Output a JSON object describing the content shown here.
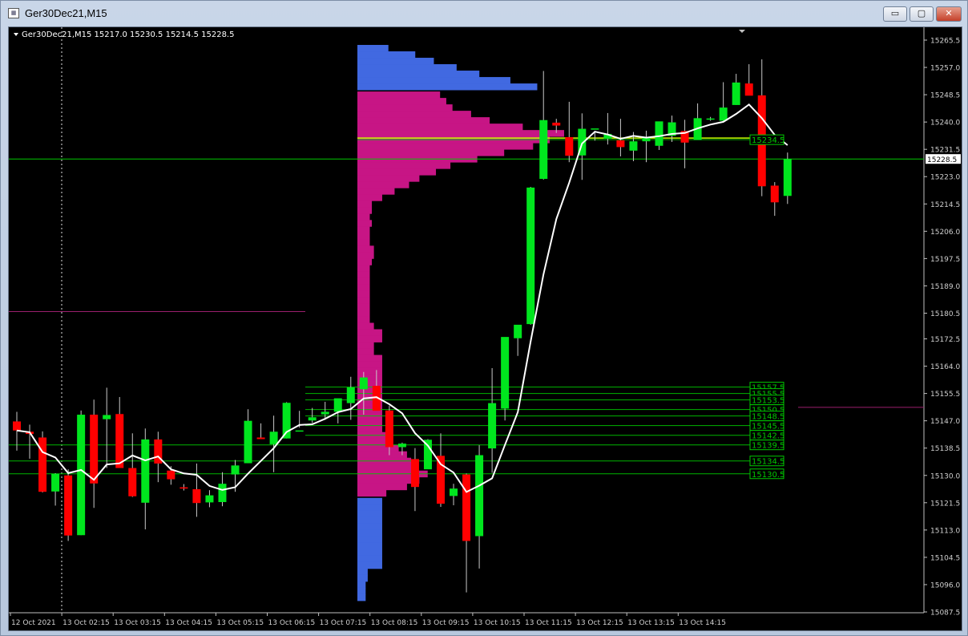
{
  "window": {
    "title": "Ger30Dec21,M15",
    "icon": "chart-window-icon",
    "buttons": {
      "minimize": "▭",
      "maximize": "▢",
      "close": "✕"
    }
  },
  "chart_header": "Ger30Dec21,M15  15217.0 15230.5 15214.5 15228.5",
  "colors": {
    "background": "#000000",
    "bull": "#00e61e",
    "bear": "#ff0000",
    "profile_main": "#c71585",
    "profile_outside": "#4169e1",
    "moving_average": "#ffffff",
    "levels": "#00c800",
    "poc": "#c8ff00",
    "marker": "#9b1f6e"
  },
  "chart_data": {
    "type": "candlestick",
    "symbol": "Ger30Dec21",
    "timeframe": "M15",
    "ohlc_header": {
      "open": 15217.0,
      "high": 15230.5,
      "low": 15214.5,
      "close": 15228.5
    },
    "y_ticks": [
      15265.5,
      15257.0,
      15248.5,
      15240.0,
      15231.5,
      15223.0,
      15214.5,
      15206.0,
      15197.5,
      15189.0,
      15180.5,
      15172.5,
      15164.0,
      15155.5,
      15147.0,
      15138.5,
      15130.0,
      15121.5,
      15113.0,
      15104.5,
      15096.0,
      15087.5
    ],
    "ylim": [
      15087.5,
      15265.5
    ],
    "x_labels": [
      "12 Oct 2021",
      "13 Oct 02:15",
      "13 Oct 03:15",
      "13 Oct 04:15",
      "13 Oct 05:15",
      "13 Oct 06:15",
      "13 Oct 07:15",
      "13 Oct 08:15",
      "13 Oct 09:15",
      "13 Oct 10:15",
      "13 Oct 11:15",
      "13 Oct 12:15",
      "13 Oct 13:15",
      "13 Oct 14:15"
    ],
    "candles": [
      [
        15146.8,
        15149.8,
        15137.7,
        15144.0
      ],
      [
        15143.6,
        15145.8,
        15135.2,
        15142.9
      ],
      [
        15141.8,
        15143.7,
        15124.7,
        15124.9
      ],
      [
        15125.0,
        15130.7,
        15120.6,
        15130.5
      ],
      [
        15130.0,
        15131.9,
        15109.6,
        15111.3
      ],
      [
        15111.4,
        15150.2,
        15111.4,
        15148.9
      ],
      [
        15148.9,
        15153.6,
        15119.9,
        15127.5
      ],
      [
        15147.5,
        15157.3,
        15132.3,
        15148.8
      ],
      [
        15149.1,
        15154.4,
        15133.1,
        15132.3
      ],
      [
        15132.3,
        15143.1,
        15123.3,
        15123.5
      ],
      [
        15121.5,
        15144.6,
        15113.2,
        15141.2
      ],
      [
        15141.2,
        15143.6,
        15127.9,
        15133.7
      ],
      [
        15131.5,
        15132.9,
        15127.1,
        15128.8
      ],
      [
        15126.3,
        15127.3,
        15125.3,
        15125.9
      ],
      [
        15125.7,
        15133.7,
        15117.1,
        15121.4
      ],
      [
        15121.6,
        15125.4,
        15120.1,
        15123.8
      ],
      [
        15121.7,
        15131.0,
        15120.4,
        15127.4
      ],
      [
        15130.3,
        15134.8,
        15124.9,
        15133.1
      ],
      [
        15133.8,
        15150.6,
        15133.8,
        15147.0
      ],
      [
        15141.8,
        15146.2,
        15141.4,
        15141.3
      ],
      [
        15139.7,
        15148.6,
        15131.0,
        15143.6
      ],
      [
        15141.5,
        15152.8,
        15141.5,
        15152.6
      ],
      [
        15143.9,
        15150.1,
        15144.9,
        15144.0
      ],
      [
        15147.1,
        15151.0,
        15146.3,
        15148.1
      ],
      [
        15149.0,
        15152.9,
        15147.3,
        15149.8
      ],
      [
        15149.8,
        15152.1,
        15146.2,
        15154.0
      ],
      [
        15152.5,
        15160.7,
        15147.3,
        15157.4
      ],
      [
        15156.8,
        15162.2,
        15148.9,
        15160.5
      ],
      [
        15157.9,
        15162.8,
        15150.9,
        15150.1
      ],
      [
        15150.2,
        15151.7,
        15136.3,
        15138.8
      ],
      [
        15138.8,
        15140.2,
        15136.3,
        15139.9
      ],
      [
        15135.1,
        15138.5,
        15118.9,
        15126.4
      ],
      [
        15131.9,
        15141.3,
        15132.1,
        15141.1
      ],
      [
        15136.1,
        15143.1,
        15120.2,
        15121.2
      ],
      [
        15123.6,
        15127.4,
        15120.7,
        15125.9
      ],
      [
        15130.3,
        15130.6,
        15093.6,
        15109.6
      ],
      [
        15111.1,
        15139.4,
        15101.0,
        15136.3
      ],
      [
        15138.4,
        15163.4,
        15130.8,
        15152.5
      ],
      [
        15150.8,
        15167.6,
        15147.1,
        15173.1
      ],
      [
        15172.7,
        15176.8,
        15167.2,
        15176.9
      ],
      [
        15177.1,
        15219.8,
        15176.9,
        15219.6
      ],
      [
        15222.3,
        15255.9,
        15222.1,
        15240.6
      ],
      [
        15239.8,
        15241.0,
        15236.6,
        15238.9
      ],
      [
        15235.3,
        15246.3,
        15227.5,
        15229.5
      ],
      [
        15229.6,
        15242.7,
        15222.0,
        15237.9
      ],
      [
        15238.0,
        15237.2,
        15234.2,
        15238.0
      ],
      [
        15234.8,
        15242.8,
        15233.0,
        15236.3
      ],
      [
        15234.3,
        15241.0,
        15229.3,
        15232.2
      ],
      [
        15231.1,
        15236.9,
        15227.8,
        15234.0
      ],
      [
        15234.0,
        15237.3,
        15227.5,
        15235.2
      ],
      [
        15232.6,
        15236.5,
        15231.3,
        15240.2
      ],
      [
        15235.7,
        15242.0,
        15233.8,
        15239.9
      ],
      [
        15237.2,
        15240.7,
        15225.6,
        15233.6
      ],
      [
        15234.4,
        15245.8,
        15234.6,
        15241.2
      ],
      [
        15241.0,
        15241.6,
        15240.4,
        15241.1
      ],
      [
        15240.4,
        15252.4,
        15240.2,
        15244.5
      ],
      [
        15245.3,
        15255.0,
        15245.3,
        15252.3
      ],
      [
        15252.0,
        15258.0,
        15248.6,
        15248.2
      ],
      [
        15248.3,
        15259.5,
        15216.9,
        15220.0
      ],
      [
        15220.2,
        15221.3,
        15210.8,
        15215.0
      ],
      [
        15217.0,
        15230.5,
        15214.5,
        15228.5
      ]
    ],
    "volume_profile": {
      "rows": [
        [
          15263,
          0.15,
          "outside"
        ],
        [
          15261,
          0.28,
          "outside"
        ],
        [
          15259,
          0.37,
          "outside"
        ],
        [
          15257,
          0.48,
          "outside"
        ],
        [
          15255,
          0.59,
          "outside"
        ],
        [
          15253,
          0.74,
          "outside"
        ],
        [
          15251,
          0.87,
          "outside"
        ],
        [
          15248.5,
          0.4,
          "main"
        ],
        [
          15246.5,
          0.43,
          "main"
        ],
        [
          15244.5,
          0.46,
          "main"
        ],
        [
          15242.5,
          0.55,
          "main"
        ],
        [
          15240.5,
          0.64,
          "main"
        ],
        [
          15238.5,
          0.8,
          "main"
        ],
        [
          15236.5,
          1.0,
          "main"
        ],
        [
          15234.5,
          0.93,
          "main"
        ],
        [
          15232.5,
          0.85,
          "main"
        ],
        [
          15230.5,
          0.71,
          "main"
        ],
        [
          15228.5,
          0.58,
          "main"
        ],
        [
          15226.5,
          0.45,
          "main"
        ],
        [
          15224.5,
          0.38,
          "main"
        ],
        [
          15222.5,
          0.3,
          "main"
        ],
        [
          15220.5,
          0.25,
          "main"
        ],
        [
          15218.5,
          0.18,
          "main"
        ],
        [
          15216.5,
          0.12,
          "main"
        ],
        [
          15214.5,
          0.07,
          "main"
        ],
        [
          15212.5,
          0.07,
          "main"
        ],
        [
          15210.5,
          0.06,
          "main"
        ],
        [
          15208.5,
          0.07,
          "main"
        ],
        [
          15206.5,
          0.06,
          "main"
        ],
        [
          15204.5,
          0.06,
          "main"
        ],
        [
          15202.5,
          0.06,
          "main"
        ],
        [
          15200.5,
          0.08,
          "main"
        ],
        [
          15198.5,
          0.08,
          "main"
        ],
        [
          15196.5,
          0.07,
          "main"
        ],
        [
          15194.5,
          0.06,
          "main"
        ],
        [
          15192.5,
          0.06,
          "main"
        ],
        [
          15190.5,
          0.06,
          "main"
        ],
        [
          15188.5,
          0.06,
          "main"
        ],
        [
          15186.5,
          0.06,
          "main"
        ],
        [
          15184.5,
          0.06,
          "main"
        ],
        [
          15182.5,
          0.06,
          "main"
        ],
        [
          15180.5,
          0.06,
          "main"
        ],
        [
          15178.5,
          0.06,
          "main"
        ],
        [
          15176.5,
          0.08,
          "main"
        ],
        [
          15174.5,
          0.12,
          "main"
        ],
        [
          15172.5,
          0.12,
          "main"
        ],
        [
          15170.5,
          0.08,
          "main"
        ],
        [
          15168.5,
          0.08,
          "main"
        ],
        [
          15166.5,
          0.12,
          "main"
        ],
        [
          15164.5,
          0.12,
          "main"
        ],
        [
          15162.5,
          0.12,
          "main"
        ],
        [
          15160.5,
          0.12,
          "main"
        ],
        [
          15158.5,
          0.12,
          "main"
        ],
        [
          15156.5,
          0.12,
          "main"
        ],
        [
          15154.5,
          0.12,
          "main"
        ],
        [
          15152.5,
          0.12,
          "main"
        ],
        [
          15150.5,
          0.12,
          "main"
        ],
        [
          15148.5,
          0.12,
          "main"
        ],
        [
          15146.5,
          0.12,
          "main"
        ],
        [
          15144.5,
          0.12,
          "main"
        ],
        [
          15142.5,
          0.14,
          "main"
        ],
        [
          15140.5,
          0.17,
          "main"
        ],
        [
          15138.5,
          0.2,
          "main"
        ],
        [
          15136.5,
          0.24,
          "main"
        ],
        [
          15134.5,
          0.26,
          "main"
        ],
        [
          15132.5,
          0.28,
          "main"
        ],
        [
          15130.5,
          0.34,
          "main"
        ],
        [
          15128.5,
          0.3,
          "main"
        ],
        [
          15126.5,
          0.24,
          "main"
        ],
        [
          15124.5,
          0.14,
          "main"
        ],
        [
          15122,
          0.12,
          "outside"
        ],
        [
          15120,
          0.12,
          "outside"
        ],
        [
          15118,
          0.12,
          "outside"
        ],
        [
          15116,
          0.12,
          "outside"
        ],
        [
          15114,
          0.12,
          "outside"
        ],
        [
          15112,
          0.12,
          "outside"
        ],
        [
          15110,
          0.12,
          "outside"
        ],
        [
          15108,
          0.12,
          "outside"
        ],
        [
          15106,
          0.12,
          "outside"
        ],
        [
          15104,
          0.12,
          "outside"
        ],
        [
          15102,
          0.12,
          "outside"
        ],
        [
          15100,
          0.05,
          "outside"
        ],
        [
          15098,
          0.05,
          "outside"
        ],
        [
          15096,
          0.04,
          "outside"
        ],
        [
          15094,
          0.04,
          "outside"
        ],
        [
          15092,
          0.04,
          "outside"
        ]
      ]
    },
    "poc": 15235.0,
    "current_price": 15228.5,
    "levels": [
      15234.5,
      15157.5,
      15155.5,
      15153.5,
      15150.5,
      15148.5,
      15145.5,
      15142.5,
      15139.5,
      15134.5,
      15130.5
    ],
    "level_labels": [
      "15234.5",
      "15157.5",
      "15155.5",
      "15153.5",
      "15150.5",
      "15148.5",
      "15145.5",
      "15142.5",
      "15139.5",
      "15134.5",
      "15130.5"
    ],
    "current_price_label": "15228.5",
    "marker_lines": [
      15181.0,
      15151.2
    ]
  }
}
